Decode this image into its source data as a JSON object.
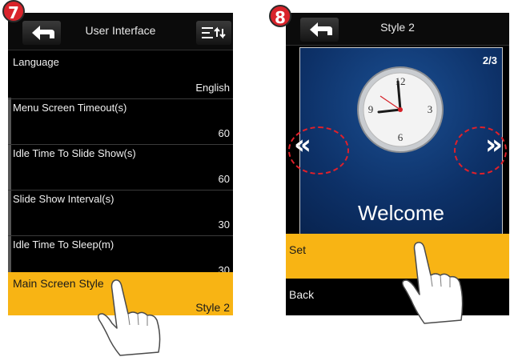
{
  "steps": {
    "step7": "7",
    "step8": "8"
  },
  "screen1": {
    "title": "User Interface",
    "items": [
      {
        "label": "Language",
        "value": "English"
      },
      {
        "label": "Menu Screen Timeout(s)",
        "value": "60"
      },
      {
        "label": "Idle Time To Slide Show(s)",
        "value": "60"
      },
      {
        "label": "Slide Show Interval(s)",
        "value": "30"
      },
      {
        "label": "Idle Time To Sleep(m)",
        "value": "30"
      },
      {
        "label": "Main Screen Style",
        "value": "Style 2"
      }
    ]
  },
  "screen2": {
    "title": "Style 2",
    "page_indicator": "2/3",
    "clock_numbers": {
      "n12": "12",
      "n3": "3",
      "n6": "6",
      "n9": "9"
    },
    "welcome": "Welcome",
    "prev_arrow": "«",
    "next_arrow": "»",
    "options": {
      "set": "Set",
      "back": "Back"
    }
  },
  "colors": {
    "highlight": "#f8b414",
    "badge": "#d9232a",
    "preview_bg": "#0d3168",
    "annotation": "#e0202a"
  },
  "icons": {
    "back": "back-arrow-icon",
    "menu": "sort-menu-icon",
    "clock": "analog-clock-icon",
    "hand": "hand-pointer-icon"
  }
}
